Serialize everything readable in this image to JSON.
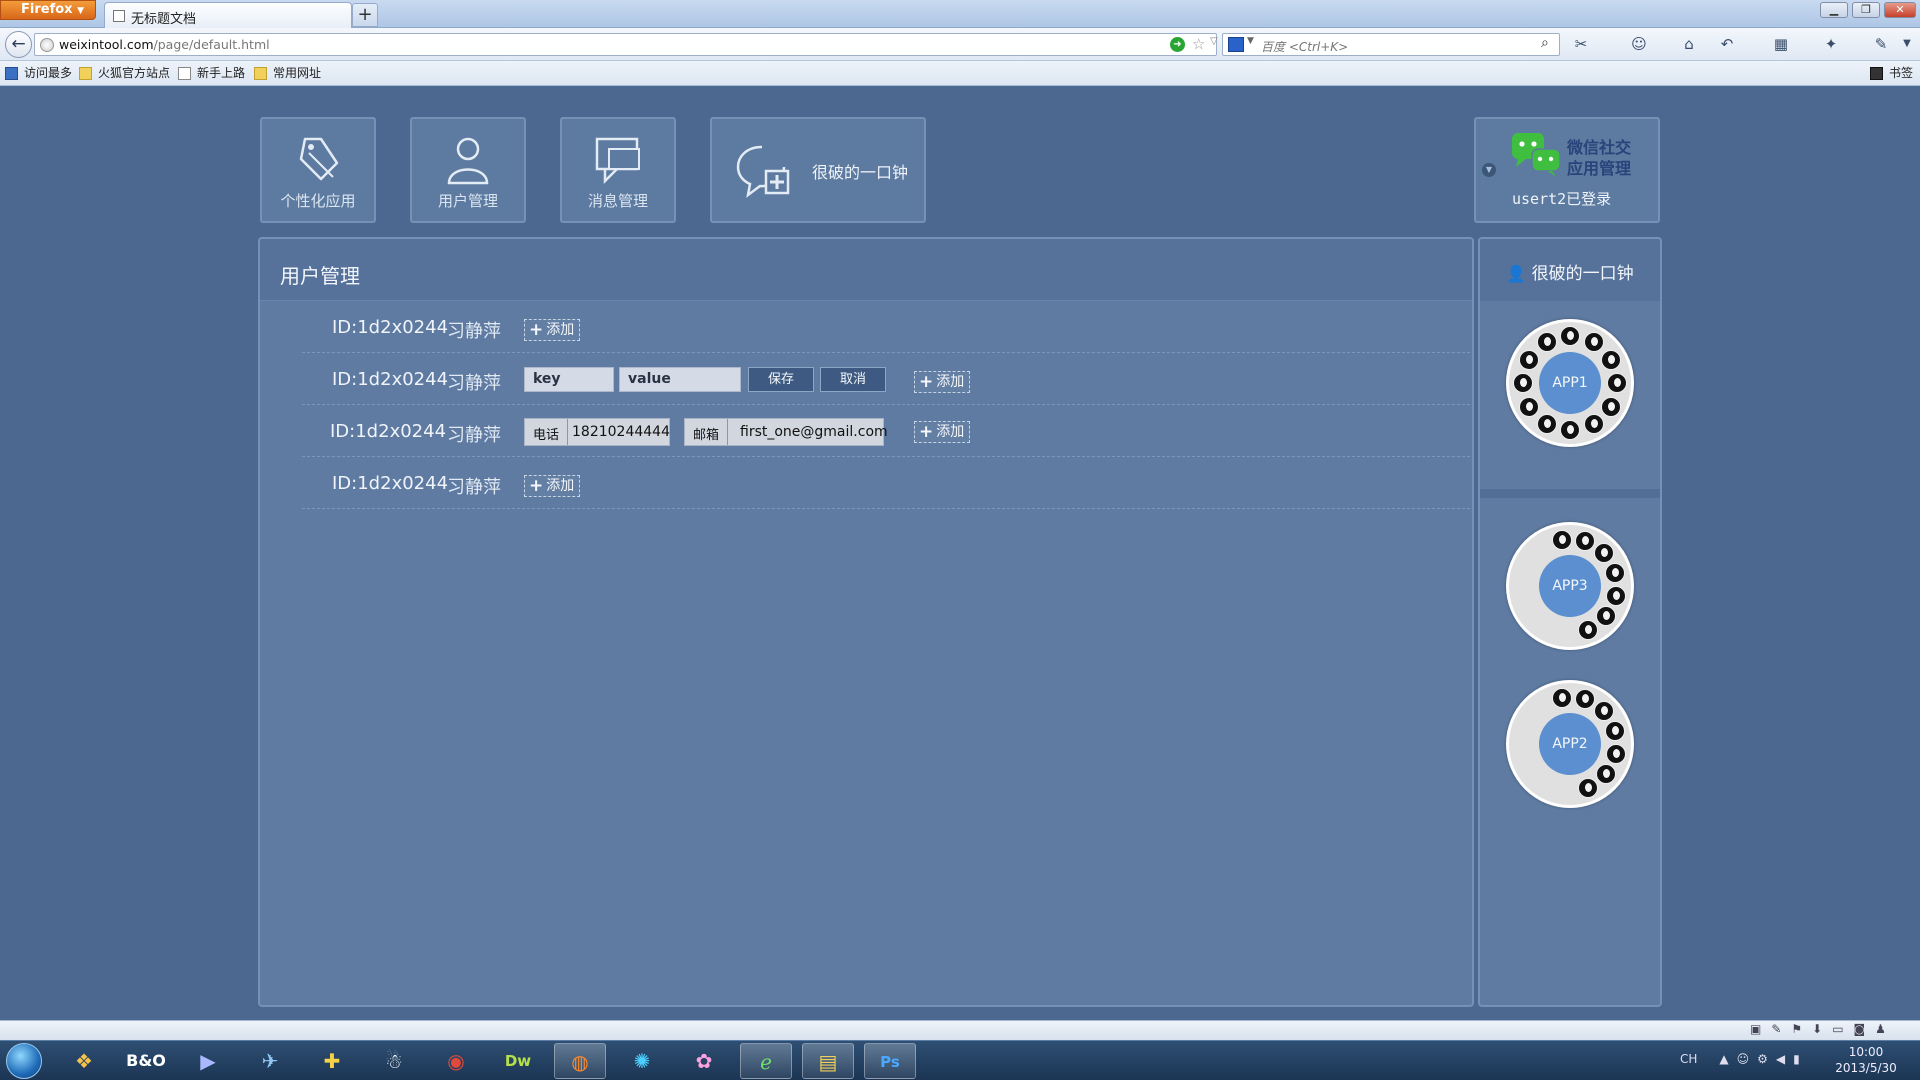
{
  "browser": {
    "app_button": "Firefox",
    "tab_title": "无标题文档",
    "url_host": "weixintool.com",
    "url_path": "/page/default.html",
    "search_placeholder": "百度 <Ctrl+K>",
    "window_controls": [
      "minimize-icon",
      "restore-icon",
      "close-icon"
    ]
  },
  "bookmarks": [
    {
      "label": "访问最多",
      "icon": "bookmark-most-visited-icon",
      "color": "#3b6fc2"
    },
    {
      "label": "火狐官方站点",
      "icon": "folder-icon",
      "color": "#f2d15a"
    },
    {
      "label": "新手上路",
      "icon": "page-icon",
      "color": "#ffffff"
    },
    {
      "label": "常用网址",
      "icon": "folder-icon",
      "color": "#f2d15a"
    }
  ],
  "bookmarks_menu": "书签",
  "nav": [
    {
      "label": "个性化应用",
      "icon": "tag-icon"
    },
    {
      "label": "用户管理",
      "icon": "user-icon"
    },
    {
      "label": "消息管理",
      "icon": "message-icon"
    },
    {
      "label": "很破的一口钟",
      "icon": "chat-add-icon"
    }
  ],
  "userbox": {
    "title_line1": "微信社交",
    "title_line2": "应用管理",
    "status": "usert2已登录",
    "icon": "wechat-icon",
    "accent": "#27457a"
  },
  "panel": {
    "title": "用户管理",
    "rows": [
      {
        "id": "ID:1d2x0244",
        "name": "习静萍",
        "add": "添加"
      },
      {
        "id": "ID:1d2x0244",
        "name": "习静萍",
        "key_placeholder": "key",
        "value_placeholder": "value",
        "save": "保存",
        "cancel": "取消",
        "add": "添加"
      },
      {
        "id": "ID:1d2x0244",
        "name": "习静萍",
        "field1_label": "电话",
        "field1_value": "18210244444",
        "field2_label": "邮箱",
        "field2_value": "first_one@gmail.com",
        "add": "添加"
      },
      {
        "id": "ID:1d2x0244",
        "name": "习静萍",
        "add": "添加"
      }
    ]
  },
  "side": {
    "title": "很破的一口钟",
    "apps": [
      "APP1",
      "APP3",
      "APP2"
    ]
  },
  "taskbar": {
    "lang": "CH",
    "time": "10:00",
    "date": "2013/5/30"
  },
  "colors": {
    "page_bg": "#4c6890",
    "panel_bg": "#5f7ba2",
    "app_core": "#5b8fcf"
  }
}
